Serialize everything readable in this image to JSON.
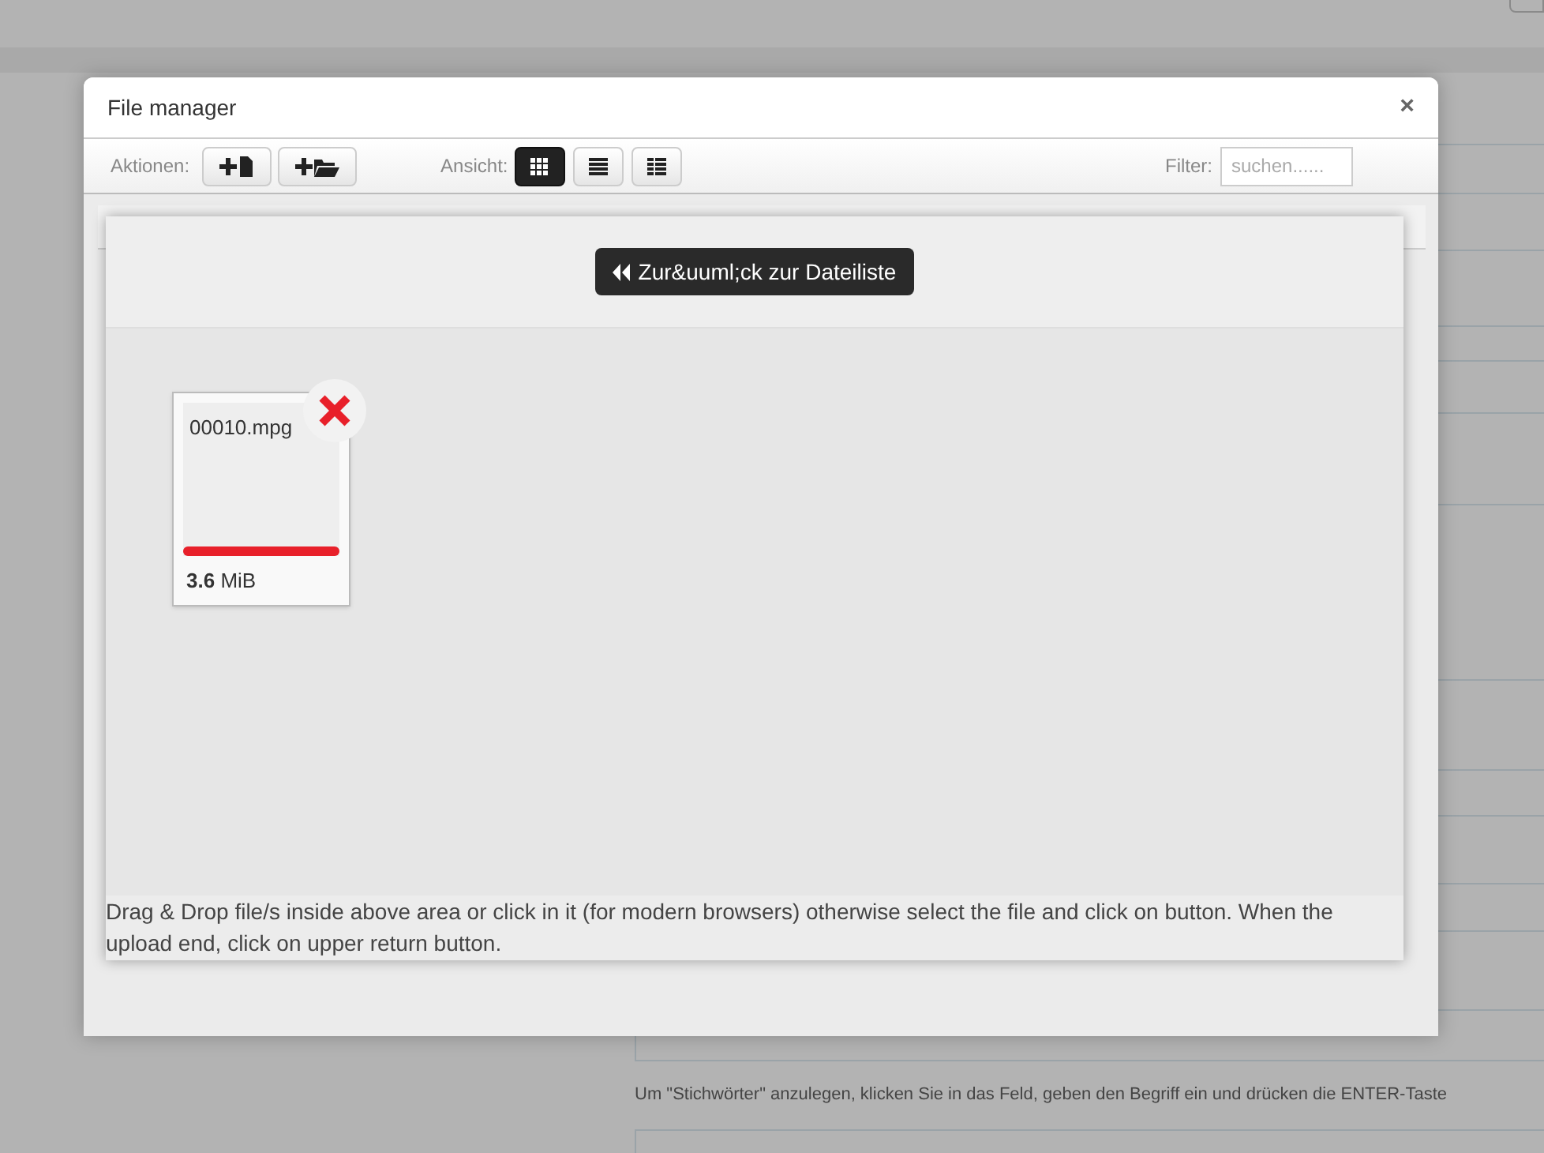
{
  "background_form": {
    "hint": "Um \"Stichwörter\" anzulegen, klicken Sie in das Feld, geben den Begriff ein und drücken die ENTER-Taste"
  },
  "modal": {
    "title": "File manager",
    "close": "×",
    "toolbar": {
      "actions_label": "Aktionen:",
      "actions": [
        {
          "kind": "new-file"
        },
        {
          "kind": "new-folder"
        }
      ],
      "view_label": "Ansicht:",
      "views": [
        {
          "kind": "grid",
          "selected": true
        },
        {
          "kind": "list",
          "selected": false
        },
        {
          "kind": "detail",
          "selected": false
        }
      ],
      "filter_label": "Filter:",
      "filter_placeholder": "suchen......"
    },
    "back_button": "Zur&uuml;ck zur Dateiliste",
    "uploads": [
      {
        "name": "00010.mpg",
        "size": "**3.6** MiB",
        "level": 1,
        "error": true
      }
    ],
    "help_text": "Drag & Drop file/s inside above area or click in it (for modern browsers) otherwise select the file and click on button. When the upload end, click on upper return button."
  }
}
